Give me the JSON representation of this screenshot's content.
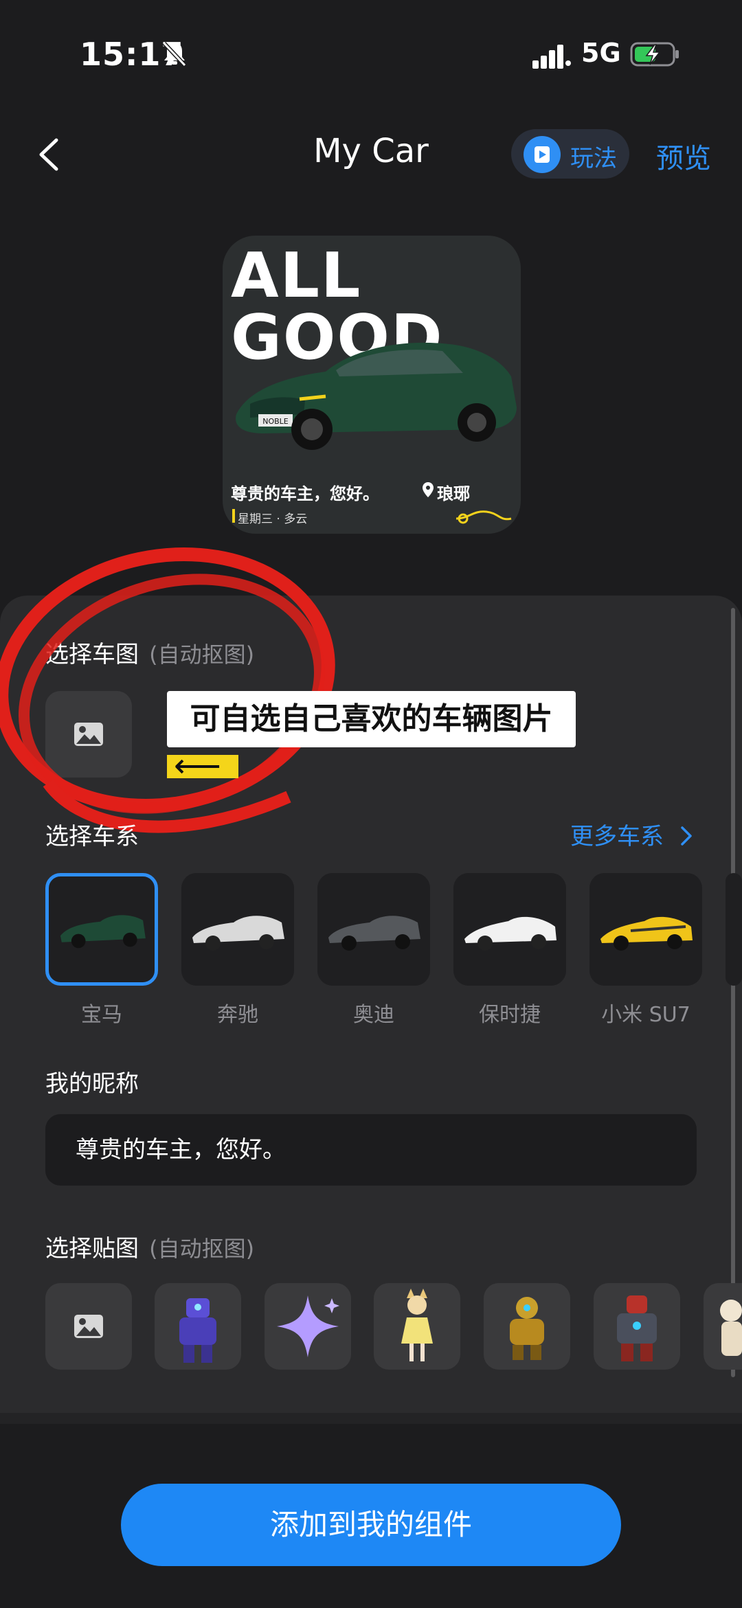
{
  "status_bar": {
    "time": "15:17",
    "network": "5G"
  },
  "nav": {
    "title": "My Car",
    "guide_label": "玩法",
    "preview_label": "预览"
  },
  "widget": {
    "headline": "ALL\nGOOD",
    "plate": "NOBLE",
    "greeting": "尊贵的车主，您好。",
    "location": "琅琊",
    "date_weather": "星期三 · 多云"
  },
  "select_car_image": {
    "label": "选择车图",
    "sub": "(自动抠图)"
  },
  "annotation": {
    "text": "可自选自己喜欢的车辆图片",
    "arrow": "⟵",
    "accent_color": "#f4d51a",
    "circle_color": "#e0201a"
  },
  "car_series": {
    "label": "选择车系",
    "more_label": "更多车系",
    "selected_index": 0,
    "items": [
      {
        "name": "宝马",
        "color": "#1e4a36"
      },
      {
        "name": "奔驰",
        "color": "#d9d9d9"
      },
      {
        "name": "奥迪",
        "color": "#55585c"
      },
      {
        "name": "保时捷",
        "color": "#f1f1f1"
      },
      {
        "name": "小米 SU7",
        "color": "#f0c419"
      }
    ]
  },
  "nickname": {
    "label": "我的昵称",
    "value": "尊贵的车主，您好。"
  },
  "stickers": {
    "label": "选择贴图",
    "sub": "(自动抠图)"
  },
  "cta": {
    "label": "添加到我的组件"
  },
  "accent_color": "#2f8ff4"
}
